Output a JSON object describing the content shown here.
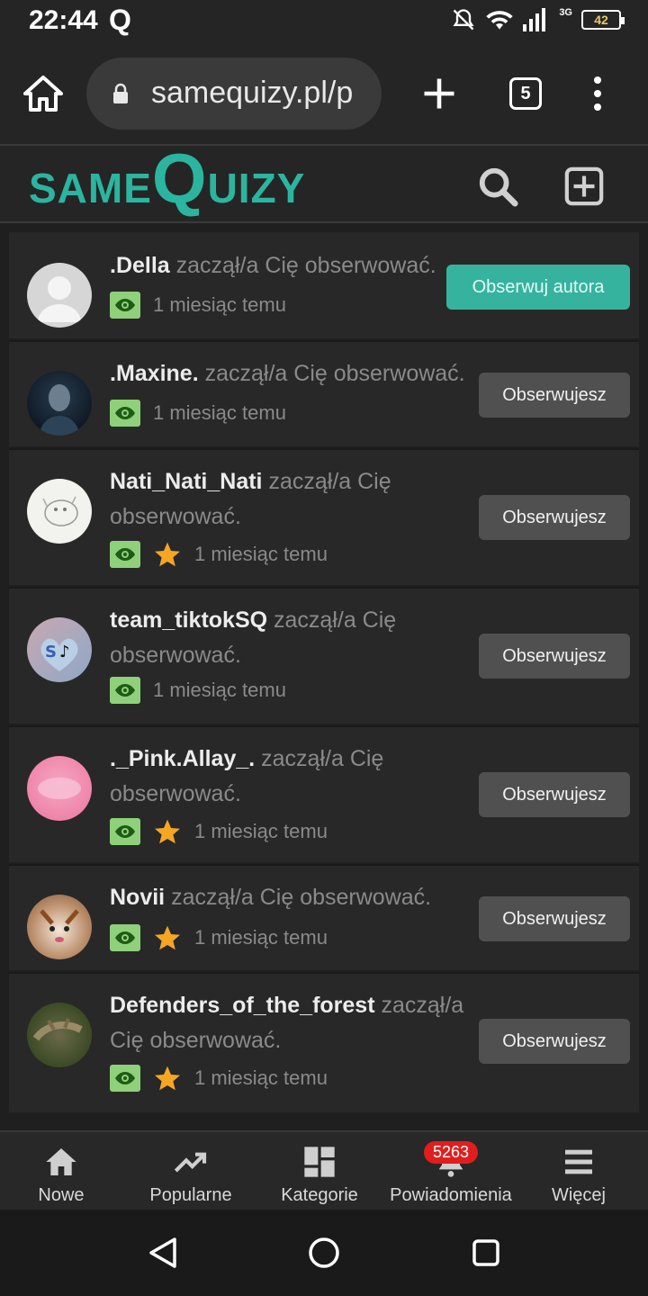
{
  "status_bar": {
    "time": "22:44",
    "app_letter": "Q",
    "network": "3G",
    "battery": "42"
  },
  "browser": {
    "url": "samequizy.pl/p",
    "tab_count": "5"
  },
  "site": {
    "logo_same": "SAME",
    "logo_q": "Q",
    "logo_uizy": "UIZY"
  },
  "notifications": [
    {
      "user": ".Della",
      "action": "zaczął/a Cię obserwować.",
      "time": "1 miesiąc temu",
      "star": false,
      "button": "Obserwuj autora"
    },
    {
      "user": ".Maxine.",
      "action": "zaczął/a Cię obserwować.",
      "time": "1 miesiąc temu",
      "star": false,
      "button": "Obserwujesz"
    },
    {
      "user": "Nati_Nati_Nati",
      "action": "zaczął/a Cię obserwować.",
      "time": "1 miesiąc temu",
      "star": true,
      "button": "Obserwujesz"
    },
    {
      "user": "team_tiktokSQ",
      "action": "zaczął/a Cię obserwować.",
      "time": "1 miesiąc temu",
      "star": false,
      "button": "Obserwujesz"
    },
    {
      "user": "._Pink.Allay_.",
      "action": "zaczął/a Cię obserwować.",
      "time": "1 miesiąc temu",
      "star": true,
      "button": "Obserwujesz"
    },
    {
      "user": "Novii",
      "action": "zaczął/a Cię obserwować.",
      "time": "1 miesiąc temu",
      "star": true,
      "button": "Obserwujesz"
    },
    {
      "user": "Defenders_of_the_forest",
      "action": "zaczął/a Cię obserwować.",
      "time": "1 miesiąc temu",
      "star": true,
      "button": "Obserwujesz"
    }
  ],
  "bottom_nav": {
    "items": [
      {
        "label": "Nowe",
        "icon": "home-icon"
      },
      {
        "label": "Popularne",
        "icon": "trending-icon"
      },
      {
        "label": "Kategorie",
        "icon": "categories-icon"
      },
      {
        "label": "Powiadomienia",
        "icon": "bell-icon",
        "badge": "5263"
      },
      {
        "label": "Więcej",
        "icon": "menu-icon"
      }
    ]
  },
  "colors": {
    "accent": "#35b39e",
    "logo": "#2bb5a0",
    "badge": "#e01e1e",
    "eye": "#8fd17a",
    "star": "#f5a623"
  }
}
